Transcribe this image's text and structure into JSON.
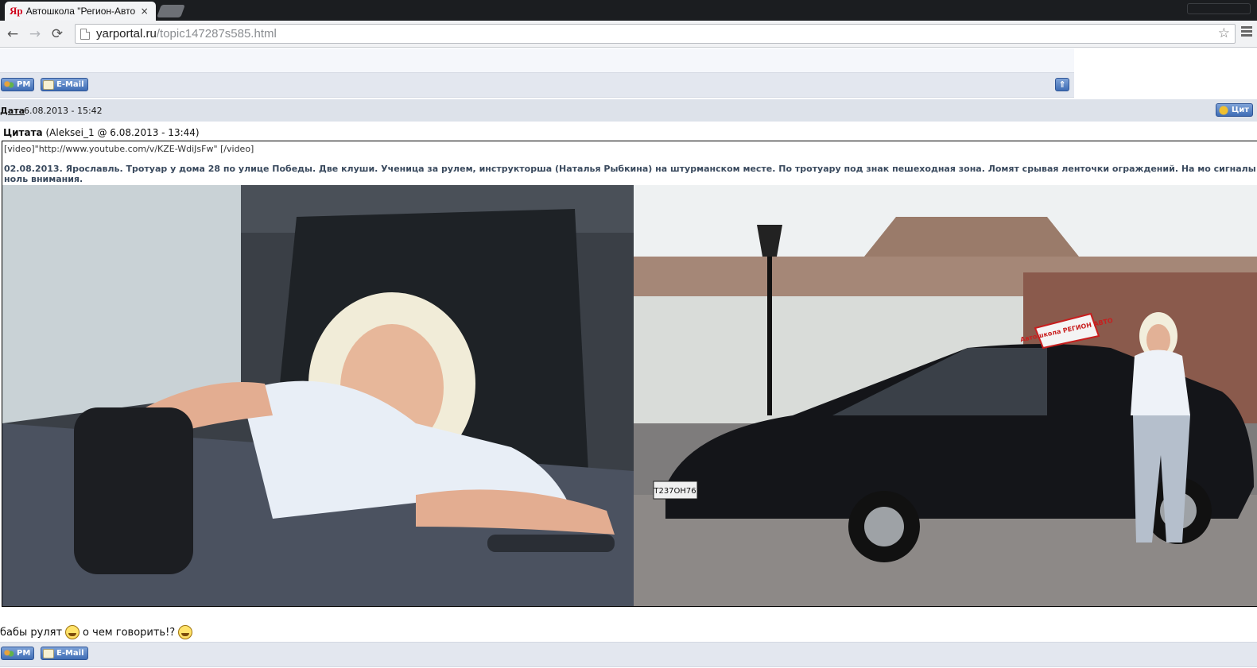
{
  "browser": {
    "tab": {
      "favicon": "Яр",
      "title": "Автошкола \"Регион-Авто",
      "close": "×"
    },
    "nav": {
      "back_icon": "←",
      "forward_icon": "→",
      "reload_icon": "⟳"
    },
    "omnibox": {
      "host": "yarportal.ru",
      "path": "/topic147287s585.html",
      "bookmark_icon": "☆"
    }
  },
  "forum": {
    "top_buttons": {
      "pm": "PM",
      "email": "E-Mail",
      "up": "⇑"
    },
    "post": {
      "date_label": "Дата",
      "date_value": "6.08.2013 - 15:42",
      "quote_button": "Цит",
      "quote_header_label": "Цитата",
      "quote_header_meta": "(Aleksei_1 @ 6.08.2013 - 13:44)",
      "video_tag": "[video]\"http://www.youtube.com/v/KZE-WdiJsFw\" [/video]",
      "quoted_text": "02.08.2013. Ярославль. Тротуар у дома 28 по улице Победы. Две клуши. Ученица за рулем, инструкторша (Наталья Рыбкина) на штурманском месте. По тротуару под знак пешеходная зона. Ломят срывая ленточки ограждений. На мо сигналы ноль внимания.",
      "photo_left_name": "instructor-in-car-photo",
      "photo_right_name": "instructor-with-car-photo",
      "sign_text": "Автошкола РЕГИОН АВТО",
      "plate_text": "Т237ОН76",
      "reply_text_1": "бабы рулят",
      "reply_text_2": "о чем говорить!?"
    },
    "bottom_buttons": {
      "pm": "PM",
      "email": "E-Mail"
    }
  },
  "colors": {
    "accent": "#3f6db5",
    "bar_bg": "#e3e7ef",
    "quote_text": "#3a4a5e"
  }
}
